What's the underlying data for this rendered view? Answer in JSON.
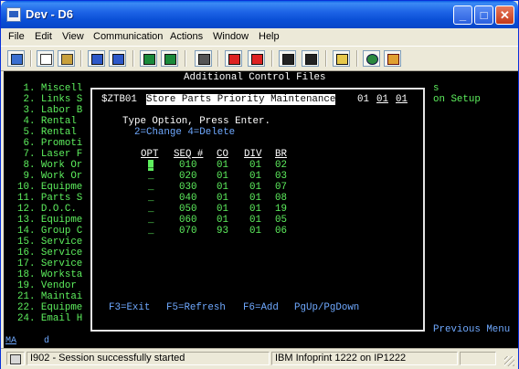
{
  "window": {
    "title": "Dev - D6"
  },
  "menu": [
    "File",
    "Edit",
    "View",
    "Communication",
    "Actions",
    "Window",
    "Help"
  ],
  "toolbar_icons": [
    "print-screen-icon",
    "copy-icon",
    "paste-icon",
    "send-icon",
    "receive-icon",
    "display-icon",
    "keyboard-icon",
    "macro-icon",
    "record-icon",
    "play-icon",
    "stop-icon",
    "clipboard-icon",
    "globe-icon",
    "tag-icon"
  ],
  "background": {
    "header": "Additional Control Files",
    "items": [
      " 1. Miscell",
      " 2. Links S",
      " 3. Labor B",
      " 4. Rental ",
      " 5. Rental ",
      " 6. Promoti",
      " 7. Laser F",
      " 8. Work Or",
      " 9. Work Or",
      "10. Equipme",
      "11. Parts S",
      "12. D.O.C. ",
      "13. Equipme",
      "14. Group C",
      "15. Service",
      "16. Service",
      "17. Service",
      "18. Worksta",
      "19. Vendor ",
      "21. Maintai",
      "22. Equipme",
      "24. Email H"
    ],
    "right_s": "s",
    "right_setup": "on Setup",
    "previous_menu": "Previous Menu"
  },
  "popup": {
    "program": "$ZTB01",
    "title": "Store Parts Priority Maintenance",
    "co": "01",
    "div": "01",
    "br": "01",
    "instruction": "Type Option, Press Enter.",
    "options": "2=Change 4=Delete",
    "columns": [
      "OPT",
      "SEQ #",
      "CO",
      "DIV",
      "BR"
    ],
    "rows": [
      {
        "seq": "010",
        "co": "01",
        "div": "01",
        "br": "02"
      },
      {
        "seq": "020",
        "co": "01",
        "div": "01",
        "br": "03"
      },
      {
        "seq": "030",
        "co": "01",
        "div": "01",
        "br": "07"
      },
      {
        "seq": "040",
        "co": "01",
        "div": "01",
        "br": "08"
      },
      {
        "seq": "050",
        "co": "01",
        "div": "01",
        "br": "19"
      },
      {
        "seq": "060",
        "co": "01",
        "div": "01",
        "br": "05"
      },
      {
        "seq": "070",
        "co": "93",
        "div": "01",
        "br": "06"
      }
    ],
    "fkeys": [
      "F3=Exit",
      "F5=Refresh",
      "F6=Add",
      "PgUp/PgDown"
    ]
  },
  "oia": {
    "mode": "MA",
    "flag": "d"
  },
  "status": {
    "message": "I902 - Session successfully started",
    "printer": "IBM Infoprint 1222 on IP1222"
  }
}
